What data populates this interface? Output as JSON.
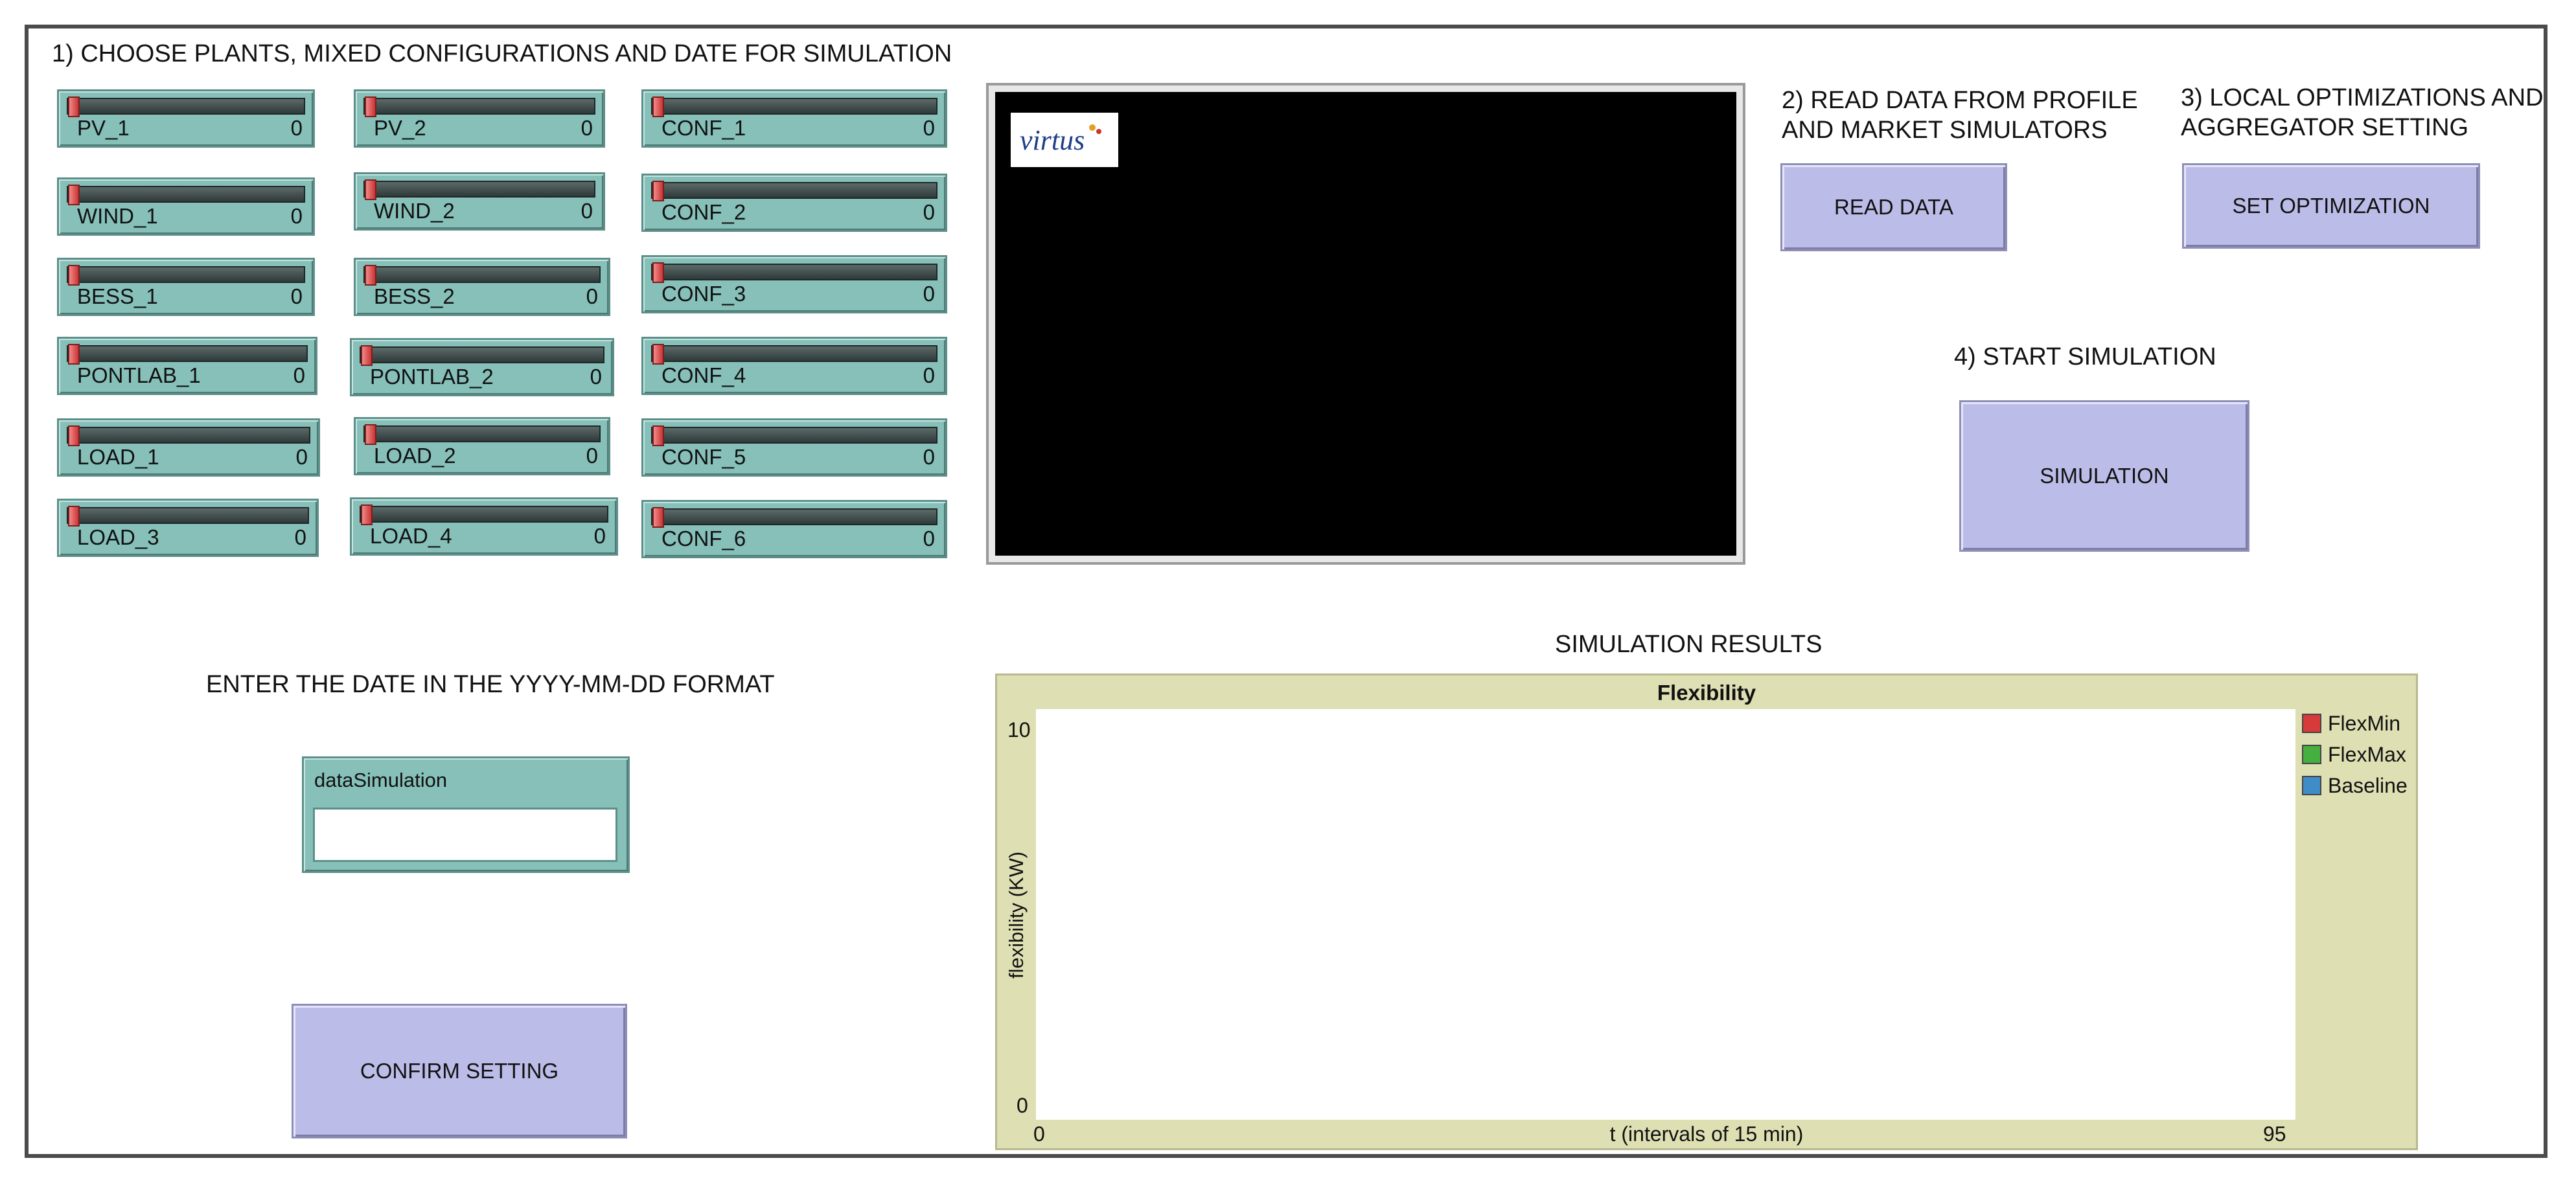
{
  "headings": {
    "step1": "1) CHOOSE PLANTS, MIXED CONFIGURATIONS AND DATE FOR SIMULATION",
    "step2": "2) READ DATA FROM PROFILE\nAND MARKET SIMULATORS",
    "step3": "3) LOCAL OPTIMIZATIONS AND\nAGGREGATOR SETTING",
    "step4": "4) START SIMULATION",
    "date_instruction": "ENTER THE DATE IN THE YYYY-MM-DD FORMAT",
    "results": "SIMULATION RESULTS"
  },
  "sliders": [
    {
      "label": "PV_1",
      "value": "0",
      "level": 0
    },
    {
      "label": "PV_2",
      "value": "0",
      "level": 0
    },
    {
      "label": "CONF_1",
      "value": "0",
      "level": 0
    },
    {
      "label": "WIND_1",
      "value": "0",
      "level": 0
    },
    {
      "label": "WIND_2",
      "value": "0",
      "level": 0
    },
    {
      "label": "CONF_2",
      "value": "0",
      "level": 0
    },
    {
      "label": "BESS_1",
      "value": "0",
      "level": 0
    },
    {
      "label": "BESS_2",
      "value": "0",
      "level": 0
    },
    {
      "label": "CONF_3",
      "value": "0",
      "level": 0
    },
    {
      "label": "PONTLAB_1",
      "value": "0",
      "level": 0
    },
    {
      "label": "PONTLAB_2",
      "value": "0",
      "level": 0
    },
    {
      "label": "CONF_4",
      "value": "0",
      "level": 0
    },
    {
      "label": "LOAD_1",
      "value": "0",
      "level": 0
    },
    {
      "label": "LOAD_2",
      "value": "0",
      "level": 0
    },
    {
      "label": "CONF_5",
      "value": "0",
      "level": 0
    },
    {
      "label": "LOAD_3",
      "value": "0",
      "level": 0
    },
    {
      "label": "LOAD_4",
      "value": "0",
      "level": 0
    },
    {
      "label": "CONF_6",
      "value": "0",
      "level": 0
    }
  ],
  "buttons": {
    "read_data": "READ DATA",
    "set_optimization": "SET OPTIMIZATION",
    "simulation": "SIMULATION",
    "confirm_setting": "CONFIRM SETTING"
  },
  "view": {
    "logo_icon": "virtus-logo",
    "logo_text": "virtus"
  },
  "input": {
    "label": "dataSimulation",
    "value": "",
    "placeholder": ""
  },
  "chart_data": {
    "type": "line",
    "title": "Flexibility",
    "xlabel": "t (intervals of 15 min)",
    "ylabel": "flexibility (KW)",
    "xlim": [
      0,
      95
    ],
    "ylim": [
      0,
      10
    ],
    "x_ticks": [
      "0",
      "95"
    ],
    "y_ticks": [
      "10",
      "0"
    ],
    "series": [
      {
        "name": "FlexMin",
        "color": "#d63a3a",
        "values": []
      },
      {
        "name": "FlexMax",
        "color": "#45b03f",
        "values": []
      },
      {
        "name": "Baseline",
        "color": "#3f8dc8",
        "values": []
      }
    ],
    "legend": "right",
    "grid": false
  }
}
